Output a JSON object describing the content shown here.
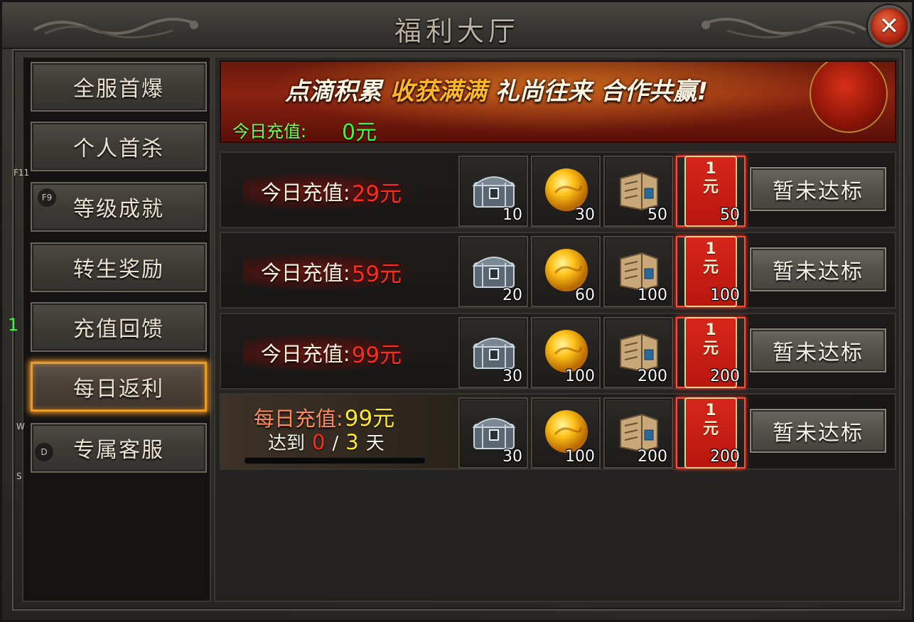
{
  "window": {
    "title": "福利大厅",
    "close_label": "✕"
  },
  "sidebar": {
    "items": [
      {
        "label": "全服首爆",
        "active": false
      },
      {
        "label": "个人首杀",
        "active": false
      },
      {
        "label": "等级成就",
        "active": false
      },
      {
        "label": "转生奖励",
        "active": false
      },
      {
        "label": "充值回馈",
        "active": false
      },
      {
        "label": "每日返利",
        "active": true
      },
      {
        "label": "专属客服",
        "active": false
      }
    ]
  },
  "hotkeys": {
    "f11": "F11",
    "f9": "F9",
    "w": "W",
    "d": "D",
    "s": "S",
    "side_marker": "1"
  },
  "banner": {
    "slogan_part1": "点滴积累",
    "slogan_part2": "收获满满",
    "slogan_part3": "礼尚往来",
    "slogan_part4": "合作共赢!",
    "today_recharge_label": "今日充值:",
    "today_recharge_value": "0元"
  },
  "tiers": [
    {
      "label": "今日充值:",
      "value": "29元",
      "rewards": [
        {
          "item": "chest-icon",
          "qty": "10"
        },
        {
          "item": "gold-orb-icon",
          "qty": "30"
        },
        {
          "item": "scroll-book-icon",
          "qty": "50"
        },
        {
          "item": "red-packet-icon",
          "qty": "50"
        }
      ],
      "status": "暂未达标"
    },
    {
      "label": "今日充值:",
      "value": "59元",
      "rewards": [
        {
          "item": "chest-icon",
          "qty": "20"
        },
        {
          "item": "gold-orb-icon",
          "qty": "60"
        },
        {
          "item": "scroll-book-icon",
          "qty": "100"
        },
        {
          "item": "red-packet-icon",
          "qty": "100"
        }
      ],
      "status": "暂未达标"
    },
    {
      "label": "今日充值:",
      "value": "99元",
      "rewards": [
        {
          "item": "chest-icon",
          "qty": "30"
        },
        {
          "item": "gold-orb-icon",
          "qty": "100"
        },
        {
          "item": "scroll-book-icon",
          "qty": "200"
        },
        {
          "item": "red-packet-icon",
          "qty": "200"
        }
      ],
      "status": "暂未达标"
    }
  ],
  "daily_tier": {
    "label": "每日充值:",
    "value": "99元",
    "progress_prefix": "达到",
    "progress_current": "0",
    "progress_sep": "/",
    "progress_max": "3",
    "progress_suffix": "天",
    "progress_fraction": 0,
    "rewards": [
      {
        "item": "chest-icon",
        "qty": "30"
      },
      {
        "item": "gold-orb-icon",
        "qty": "100"
      },
      {
        "item": "scroll-book-icon",
        "qty": "200"
      },
      {
        "item": "red-packet-icon",
        "qty": "200"
      }
    ],
    "status": "暂未达标"
  },
  "red_packet_text": "1\n元",
  "colors": {
    "accent_orange": "#e89a2a",
    "recharge_green": "#31ff3a",
    "value_red": "#ff2a1e",
    "value_yellow": "#ffe82a"
  }
}
